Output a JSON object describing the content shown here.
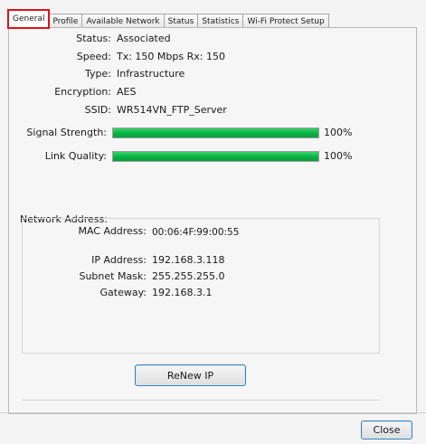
{
  "tabs": [
    "General",
    "Profile",
    "Available Network",
    "Status",
    "Statistics",
    "Wi-Fi Protect Setup"
  ],
  "active_tab": "General",
  "colors": {
    "active_tab_outline": "#d8141a",
    "bar_fill": "#0bb447"
  },
  "general": {
    "status_label": "Status:",
    "status_value": "Associated",
    "speed_label": "Speed:",
    "speed_value": "Tx: 150 Mbps Rx: 150",
    "type_label": "Type:",
    "type_value": "Infrastructure",
    "encryption_label": "Encryption:",
    "encryption_value": "AES",
    "ssid_label": "SSID:",
    "ssid_value": "WR514VN_FTP_Server",
    "signal_label": "Signal Strength:",
    "signal_value": "100%",
    "signal_fraction": 1.0,
    "link_label": "Link Quality:",
    "link_value": "100%",
    "link_fraction": 1.0
  },
  "network": {
    "group_label": "Network Address:",
    "mac_label": "MAC Address:",
    "mac_value": "00:06:4F:99:00:55",
    "ip_label": "IP Address:",
    "ip_value": "192.168.3.118",
    "subnet_label": "Subnet Mask:",
    "subnet_value": "255.255.255.0",
    "gateway_label": "Gateway:",
    "gateway_value": "192.168.3.1"
  },
  "buttons": {
    "renew": "ReNew IP",
    "close": "Close"
  }
}
